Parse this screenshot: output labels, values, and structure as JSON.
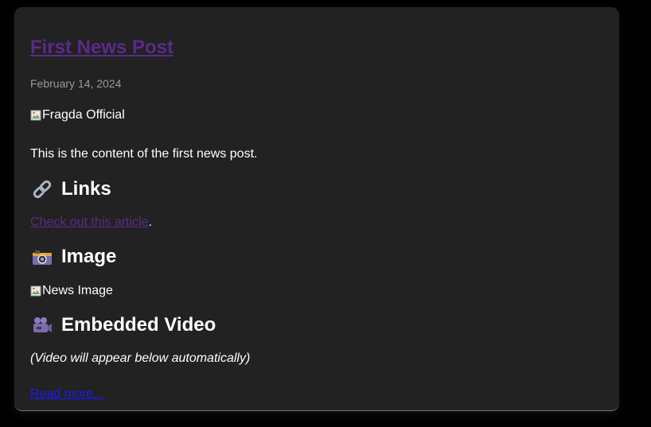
{
  "post": {
    "title": "First News Post",
    "date": "February 14, 2024",
    "header_image_alt": "Fragda Official",
    "content": "This is the content of the first news post.",
    "sections": {
      "links": {
        "icon": "link-icon",
        "heading": "Links",
        "link_text": "Check out this article",
        "trailing": "."
      },
      "image": {
        "icon": "camera-icon",
        "heading": "Image",
        "image_alt": "News Image"
      },
      "video": {
        "icon": "video-camera-icon",
        "heading": "Embedded Video",
        "note": "(Video will appear below automatically)"
      }
    },
    "read_more": "Read more..."
  },
  "colors": {
    "page_background": "#000000",
    "card_background": "#222222",
    "title_link": "#5b2a8a",
    "read_more_link": "#1a1aff",
    "date_text": "#9a9a9a"
  }
}
